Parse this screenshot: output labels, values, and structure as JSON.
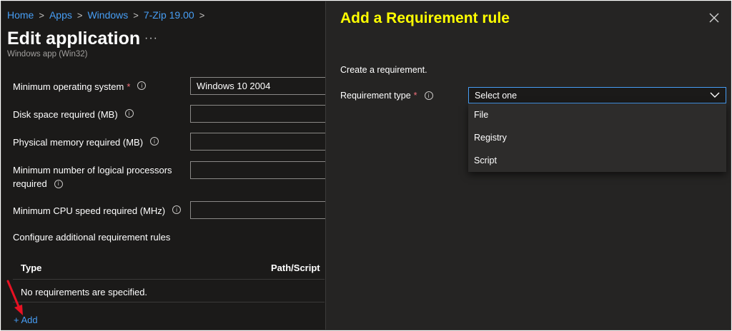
{
  "breadcrumb": [
    {
      "label": "Home"
    },
    {
      "label": "Apps"
    },
    {
      "label": "Windows"
    },
    {
      "label": "7-Zip 19.00"
    }
  ],
  "header": {
    "title": "Edit application",
    "more": "···",
    "subtitle": "Windows app (Win32)"
  },
  "form": {
    "min_os": {
      "label": "Minimum operating system",
      "required_mark": "*",
      "value": "Windows 10 2004"
    },
    "disk_space": {
      "label": "Disk space required (MB)",
      "value": ""
    },
    "physical_memory": {
      "label": "Physical memory required (MB)",
      "value": ""
    },
    "logical_processors": {
      "label_line1": "Minimum number of logical processors",
      "label_line2": "required",
      "value": ""
    },
    "cpu_speed": {
      "label": "Minimum CPU speed required (MHz)",
      "value": ""
    },
    "additional_rules_label": "Configure additional requirement rules"
  },
  "table": {
    "columns": [
      "Type",
      "Path/Script"
    ],
    "empty_message": "No requirements are specified.",
    "add_link": "+ Add"
  },
  "panel": {
    "title": "Add a Requirement rule",
    "intro": "Create a requirement.",
    "requirement_type_label": "Requirement type",
    "required_mark": "*",
    "dropdown_value": "Select one",
    "options": [
      "File",
      "Registry",
      "Script"
    ]
  },
  "icons": {
    "info": "info-circle-icon",
    "close": "close-icon",
    "chevron": "chevron-down-icon",
    "breadcrumb_separator": "chevron-right-icon",
    "annotation": "red-arrow-icon"
  },
  "colors": {
    "link": "#479ef5",
    "panel_title": "#ffff00",
    "required": "#f1707b",
    "annotation_arrow": "#e81123"
  }
}
